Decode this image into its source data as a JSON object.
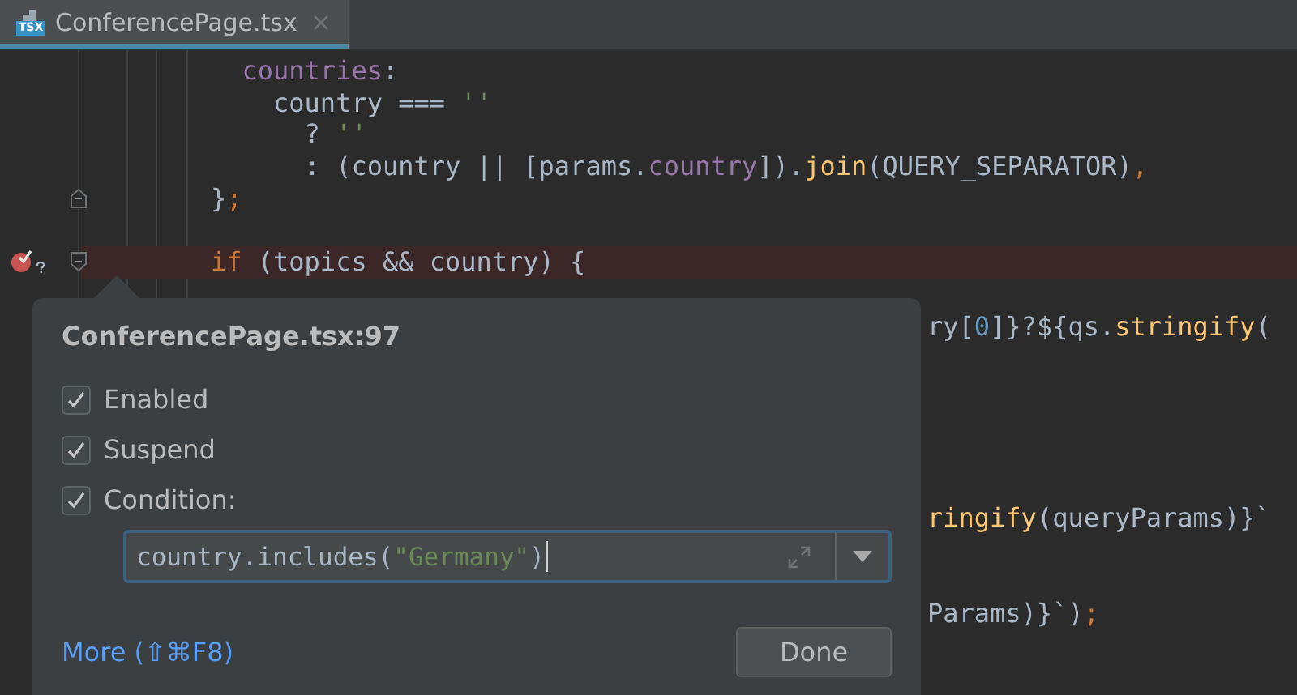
{
  "tab": {
    "label": "ConferencePage.tsx",
    "icon_text": "TSX",
    "selected": true
  },
  "editor": {
    "lines": [
      {
        "segments": [
          {
            "text": "  countries",
            "kind": "prop"
          },
          {
            "text": ":",
            "kind": "plain"
          }
        ]
      },
      {
        "segments": [
          {
            "text": "    country === ",
            "kind": "plain"
          },
          {
            "text": "''",
            "kind": "string"
          }
        ]
      },
      {
        "segments": [
          {
            "text": "      ? ",
            "kind": "plain"
          },
          {
            "text": "''",
            "kind": "string"
          }
        ]
      },
      {
        "segments": [
          {
            "text": "      : (country || [params.",
            "kind": "plain"
          },
          {
            "text": "country",
            "kind": "prop"
          },
          {
            "text": "]).",
            "kind": "plain"
          },
          {
            "text": "join",
            "kind": "func"
          },
          {
            "text": "(QUERY_SEPARATOR)",
            "kind": "plain"
          },
          {
            "text": ",",
            "kind": "keyword"
          }
        ]
      },
      {
        "kind": "fold_end",
        "segments": [
          {
            "text": "}",
            "kind": "plain"
          },
          {
            "text": ";",
            "kind": "keyword"
          }
        ]
      },
      {
        "kind": "blank"
      },
      {
        "kind": "fold_start",
        "breakpoint": true,
        "highlighted": true,
        "segments": [
          {
            "text": "if",
            "kind": "keyword"
          },
          {
            "text": " (topics && country) {",
            "kind": "plain"
          }
        ]
      },
      {
        "kind": "blank"
      },
      {
        "covered": true,
        "segments": [
          {
            "text": "ry[",
            "kind": "plain"
          },
          {
            "text": "0",
            "kind": "number"
          },
          {
            "text": "]}?${qs.",
            "kind": "plain"
          },
          {
            "text": "stringify",
            "kind": "func"
          },
          {
            "text": "(",
            "kind": "plain"
          }
        ]
      },
      {
        "kind": "blank"
      },
      {
        "kind": "blank"
      },
      {
        "kind": "blank"
      },
      {
        "kind": "blank"
      },
      {
        "kind": "blank"
      },
      {
        "covered": true,
        "segments": [
          {
            "text": "ringify",
            "kind": "func"
          },
          {
            "text": "(queryParams)}`",
            "kind": "plain"
          }
        ]
      },
      {
        "kind": "blank"
      },
      {
        "kind": "blank"
      },
      {
        "covered": true,
        "segments": [
          {
            "text": "Params)}`)",
            "kind": "plain"
          },
          {
            "text": ";",
            "kind": "keyword"
          }
        ]
      }
    ]
  },
  "popup": {
    "title": "ConferencePage.tsx:97",
    "options": [
      {
        "label": "Enabled",
        "checked": true
      },
      {
        "label": "Suspend",
        "checked": true
      },
      {
        "label": "Condition:",
        "checked": true
      }
    ],
    "condition": {
      "segments": [
        {
          "text": "country.includes(",
          "kind": "plain"
        },
        {
          "text": "\"Germany\"",
          "kind": "string"
        },
        {
          "text": ")",
          "kind": "plain"
        }
      ]
    },
    "more_link": "More (⇧⌘F8)",
    "done_button": "Done"
  }
}
